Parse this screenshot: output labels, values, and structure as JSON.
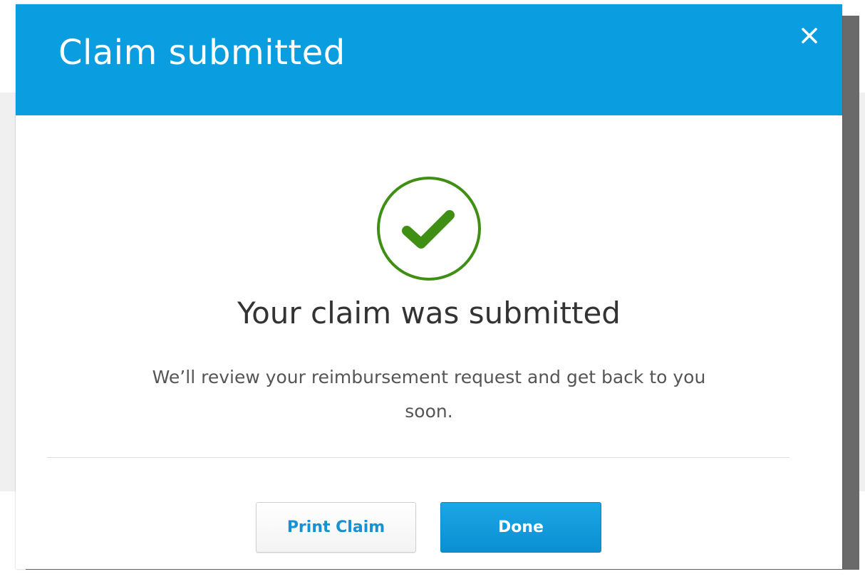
{
  "dialog": {
    "title": "Claim submitted",
    "close_icon": "close-icon",
    "header_color": "#0a9ddf"
  },
  "success": {
    "icon": "checkmark-circle-icon",
    "icon_color": "#3f8f15",
    "heading": "Your claim was submitted",
    "message": "We’ll review your reimbursement request and get back to you soon."
  },
  "actions": {
    "print_label": "Print Claim",
    "done_label": "Done",
    "primary_color": "#0b95da"
  }
}
